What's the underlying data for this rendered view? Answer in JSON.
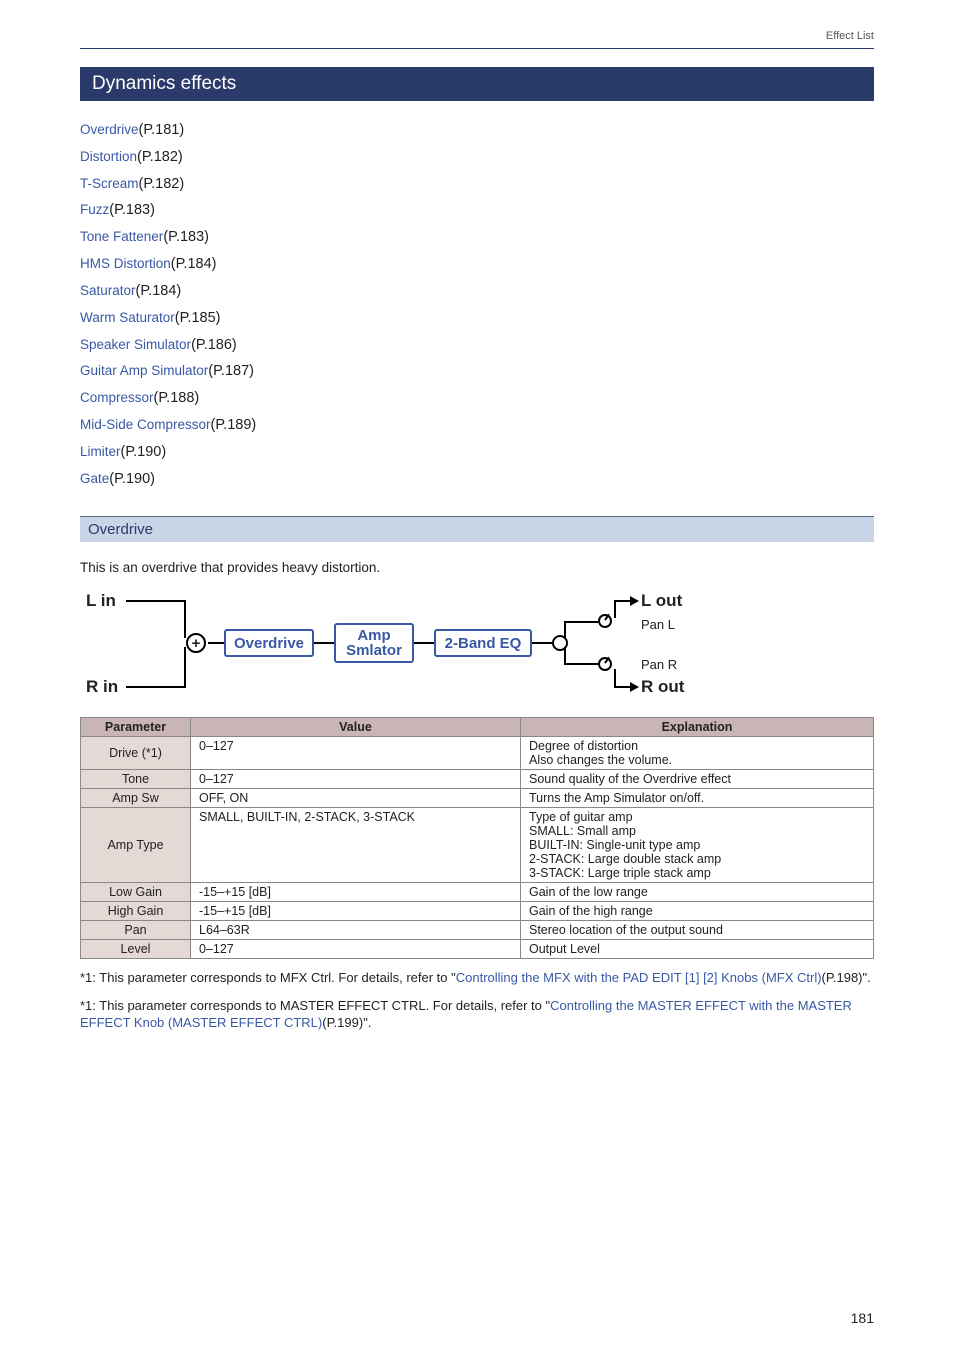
{
  "header": {
    "breadcrumb": "Effect List"
  },
  "section": {
    "title": "Dynamics effects"
  },
  "links": [
    {
      "name": "Overdrive",
      "page": "(P.181)"
    },
    {
      "name": "Distortion",
      "page": "(P.182)"
    },
    {
      "name": "T-Scream",
      "page": "(P.182)"
    },
    {
      "name": "Fuzz",
      "page": "(P.183)"
    },
    {
      "name": "Tone Fattener",
      "page": "(P.183)"
    },
    {
      "name": "HMS Distortion",
      "page": "(P.184)"
    },
    {
      "name": "Saturator",
      "page": "(P.184)"
    },
    {
      "name": "Warm Saturator",
      "page": "(P.185)"
    },
    {
      "name": "Speaker Simulator",
      "page": "(P.186)"
    },
    {
      "name": "Guitar Amp Simulator",
      "page": "(P.187)"
    },
    {
      "name": "Compressor",
      "page": "(P.188)"
    },
    {
      "name": "Mid-Side Compressor",
      "page": "(P.189)"
    },
    {
      "name": "Limiter",
      "page": "(P.190)"
    },
    {
      "name": "Gate",
      "page": "(P.190)"
    }
  ],
  "sub": {
    "title": "Overdrive",
    "intro": "This is an overdrive that provides heavy distortion."
  },
  "diagram": {
    "lin": "L in",
    "rin": "R in",
    "lout": "L out",
    "rout": "R out",
    "panl": "Pan L",
    "panr": "Pan R",
    "box1": "Overdrive",
    "box2a": "Amp",
    "box2b": "Smlator",
    "box3": "2-Band EQ",
    "plus": "+"
  },
  "table": {
    "h_param": "Parameter",
    "h_value": "Value",
    "h_expl": "Explanation",
    "rows": [
      {
        "param": "Drive (*1)",
        "value": "0–127",
        "expl": "Degree of distortion\nAlso changes the volume."
      },
      {
        "param": "Tone",
        "value": "0–127",
        "expl": "Sound quality of the Overdrive effect"
      },
      {
        "param": "Amp Sw",
        "value": "OFF, ON",
        "expl": "Turns the Amp Simulator on/off."
      },
      {
        "param": "Amp Type",
        "value": "SMALL, BUILT-IN, 2-STACK, 3-STACK",
        "expl": "Type of guitar amp\nSMALL: Small amp\nBUILT-IN: Single-unit type amp\n2-STACK: Large double stack amp\n3-STACK: Large triple stack amp"
      },
      {
        "param": "Low Gain",
        "value": "-15–+15 [dB]",
        "expl": "Gain of the low range"
      },
      {
        "param": "High Gain",
        "value": "-15–+15 [dB]",
        "expl": "Gain of the high range"
      },
      {
        "param": "Pan",
        "value": "L64–63R",
        "expl": "Stereo location of the output sound"
      },
      {
        "param": "Level",
        "value": "0–127",
        "expl": "Output Level"
      }
    ]
  },
  "footnotes": {
    "f1_pre": "*1: This parameter corresponds to MFX Ctrl. For details, refer to \"",
    "f1_link": "Controlling the MFX with the PAD EDIT [1] [2] Knobs (MFX Ctrl)",
    "f1_post": "(P.198)\".",
    "f2_pre": "*1: This parameter corresponds to MASTER EFFECT CTRL. For details, refer to \"",
    "f2_link": "Controlling the MASTER EFFECT with the MASTER EFFECT Knob (MASTER EFFECT CTRL)",
    "f2_post": "(P.199)\"."
  },
  "page_number": "181"
}
